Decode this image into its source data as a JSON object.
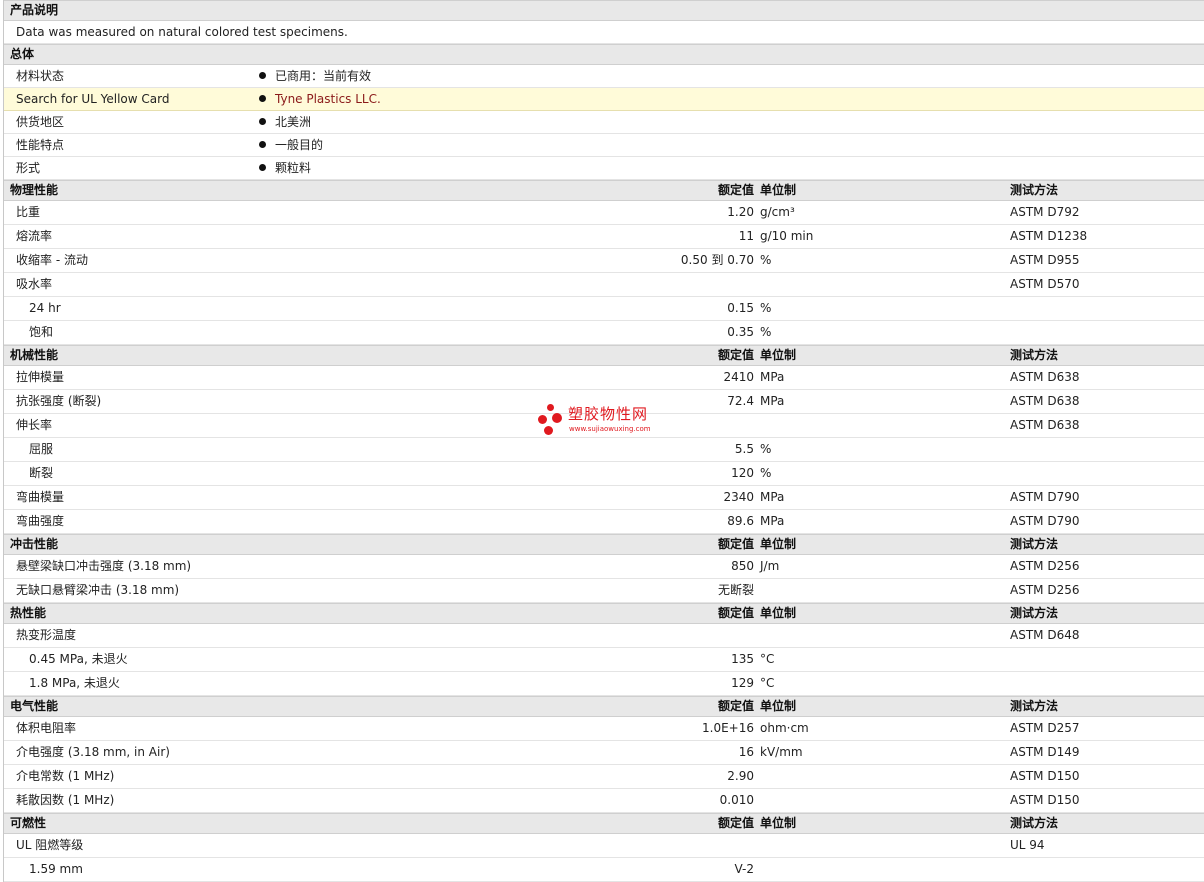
{
  "desc": {
    "title": "产品说明",
    "text": "Data was measured on natural colored test specimens."
  },
  "general": {
    "title": "总体",
    "rows": [
      {
        "label": "材料状态",
        "value": "已商用：当前有效"
      },
      {
        "label": "Search for UL Yellow Card",
        "value": "Tyne Plastics LLC."
      },
      {
        "label": "供货地区",
        "value": "北美洲"
      },
      {
        "label": "性能特点",
        "value": "一般目的"
      },
      {
        "label": "形式",
        "value": "颗粒料"
      }
    ]
  },
  "headers": {
    "value": "额定值",
    "unit": "单位制",
    "method": "测试方法"
  },
  "sections": [
    {
      "title": "物理性能",
      "rows": [
        {
          "label": "比重",
          "value": "1.20",
          "unit": "g/cm³",
          "method": "ASTM D792"
        },
        {
          "label": "熔流率",
          "value": "11",
          "unit": "g/10 min",
          "method": "ASTM D1238"
        },
        {
          "label": "收缩率  - 流动",
          "value": "0.50 到  0.70",
          "unit": "%",
          "method": "ASTM D955"
        },
        {
          "label": "吸水率",
          "value": "",
          "unit": "",
          "method": "ASTM D570"
        },
        {
          "label": "24 hr",
          "value": "0.15",
          "unit": "%",
          "method": "",
          "sub": true
        },
        {
          "label": "饱和",
          "value": "0.35",
          "unit": "%",
          "method": "",
          "sub": true
        }
      ]
    },
    {
      "title": "机械性能",
      "rows": [
        {
          "label": "拉伸模量",
          "value": "2410",
          "unit": "MPa",
          "method": "ASTM D638"
        },
        {
          "label": "抗张强度  (断裂)",
          "value": "72.4",
          "unit": "MPa",
          "method": "ASTM D638"
        },
        {
          "label": "伸长率",
          "value": "",
          "unit": "",
          "method": "ASTM D638"
        },
        {
          "label": "屈服",
          "value": "5.5",
          "unit": "%",
          "method": "",
          "sub": true
        },
        {
          "label": "断裂",
          "value": "120",
          "unit": "%",
          "method": "",
          "sub": true
        },
        {
          "label": "弯曲模量",
          "value": "2340",
          "unit": "MPa",
          "method": "ASTM D790"
        },
        {
          "label": "弯曲强度",
          "value": "89.6",
          "unit": "MPa",
          "method": "ASTM D790"
        }
      ]
    },
    {
      "title": "冲击性能",
      "rows": [
        {
          "label": "悬壁梁缺口冲击强度  (3.18 mm)",
          "value": "850",
          "unit": "J/m",
          "method": "ASTM D256"
        },
        {
          "label": "无缺口悬臂梁冲击  (3.18 mm)",
          "value": "无断裂",
          "unit": "",
          "method": "ASTM D256"
        }
      ]
    },
    {
      "title": "热性能",
      "rows": [
        {
          "label": "热变形温度",
          "value": "",
          "unit": "",
          "method": "ASTM D648"
        },
        {
          "label": "0.45 MPa, 未退火",
          "value": "135",
          "unit": "°C",
          "method": "",
          "sub": true
        },
        {
          "label": "1.8 MPa, 未退火",
          "value": "129",
          "unit": "°C",
          "method": "",
          "sub": true
        }
      ]
    },
    {
      "title": "电气性能",
      "rows": [
        {
          "label": "体积电阻率",
          "value": "1.0E+16",
          "unit": "ohm·cm",
          "method": "ASTM D257"
        },
        {
          "label": "介电强度  (3.18 mm, in Air)",
          "value": "16",
          "unit": "kV/mm",
          "method": "ASTM D149"
        },
        {
          "label": "介电常数  (1 MHz)",
          "value": "2.90",
          "unit": "",
          "method": "ASTM D150"
        },
        {
          "label": "耗散因数  (1 MHz)",
          "value": "0.010",
          "unit": "",
          "method": "ASTM D150"
        }
      ]
    },
    {
      "title": "可燃性",
      "rows": [
        {
          "label": "UL 阻燃等级",
          "value": "",
          "unit": "",
          "method": "UL 94"
        },
        {
          "label": "1.59 mm",
          "value": "V-2",
          "unit": "",
          "method": "",
          "sub": true
        }
      ]
    }
  ],
  "watermark": {
    "name": "塑胶物性网",
    "url": "www.sujiaowuxing.com"
  }
}
